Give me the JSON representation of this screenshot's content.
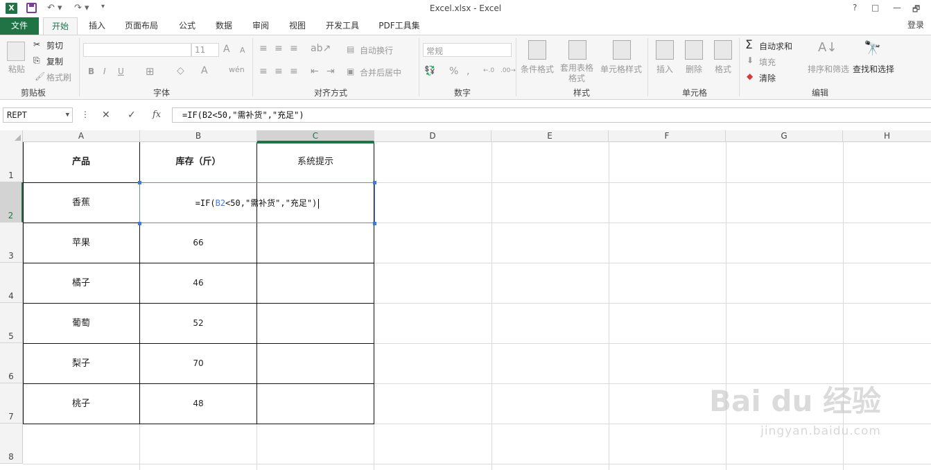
{
  "window": {
    "title": "Excel.xlsx - Excel",
    "help": "?",
    "restore": "□",
    "min": "—",
    "max": "🗗"
  },
  "tabs": {
    "file": "文件",
    "items": [
      "开始",
      "插入",
      "页面布局",
      "公式",
      "数据",
      "审阅",
      "视图",
      "开发工具",
      "PDF工具集"
    ],
    "login": "登录"
  },
  "ribbon": {
    "clipboard": {
      "label": "剪贴板",
      "paste": "粘贴",
      "cut": "剪切",
      "copy": "复制",
      "format_painter": "格式刷"
    },
    "font": {
      "label": "字体",
      "size": "11",
      "bold": "B",
      "italic": "I",
      "underline": "U",
      "grow": "A",
      "shrink": "A"
    },
    "alignment": {
      "label": "对齐方式",
      "wrap": "自动换行",
      "merge": "合并后居中"
    },
    "number": {
      "label": "数字",
      "format": "常规",
      "percent": "%",
      "comma": ",",
      "inc": "←.0",
      "dec": ".00→"
    },
    "styles": {
      "label": "样式",
      "conditional": "条件格式",
      "table": "套用表格格式",
      "cell_styles": "单元格样式"
    },
    "cells": {
      "label": "单元格",
      "insert": "插入",
      "delete": "删除",
      "format": "格式"
    },
    "editing": {
      "label": "编辑",
      "autosum": "自动求和",
      "fill": "填充",
      "clear": "清除",
      "sort": "排序和筛选",
      "find": "查找和选择"
    }
  },
  "formula_bar": {
    "name_box": "REPT",
    "cancel": "✕",
    "enter": "✓",
    "fx": "fx",
    "formula": "=IF(B2<50,\"需补货\",\"充足\")"
  },
  "sheet": {
    "columns": [
      "A",
      "B",
      "C",
      "D",
      "E",
      "F",
      "G",
      "H"
    ],
    "rows": [
      "1",
      "2",
      "3",
      "4",
      "5",
      "6",
      "7",
      "8"
    ],
    "header": [
      "产品",
      "库存（斤）",
      "系统提示"
    ],
    "data": [
      {
        "product": "香蕉",
        "stock": ""
      },
      {
        "product": "苹果",
        "stock": "66"
      },
      {
        "product": "橘子",
        "stock": "46"
      },
      {
        "product": "葡萄",
        "stock": "52"
      },
      {
        "product": "梨子",
        "stock": "70"
      },
      {
        "product": "桃子",
        "stock": "48"
      }
    ],
    "editing_cell": {
      "prefix": "=IF(",
      "ref": "B2",
      "suffix": "<50,\"需补货\",\"充足\")"
    }
  },
  "watermark": {
    "brand": "Bai du 经验",
    "url": "jingyan.baidu.com"
  }
}
